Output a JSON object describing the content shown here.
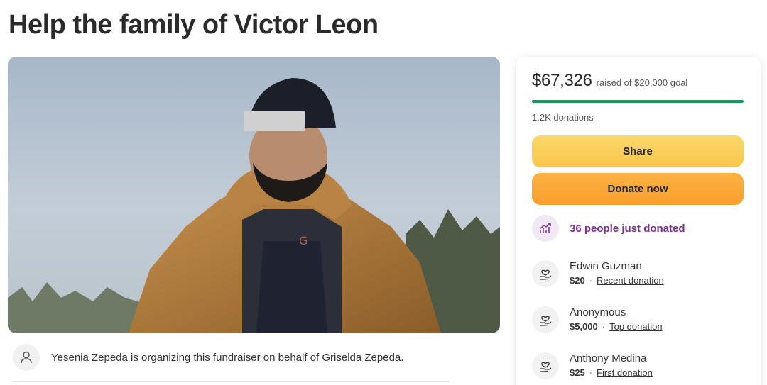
{
  "page": {
    "title": "Help the family of Victor Leon"
  },
  "organizer": {
    "text": "Yesenia Zepeda is organizing this fundraiser on behalf of Griselda Zepeda."
  },
  "card": {
    "raised": "$67,326",
    "goal_text": "raised of $20,000 goal",
    "progress_fraction": 1.0,
    "donations_count": "1.2K donations",
    "share_label": "Share",
    "donate_label": "Donate now",
    "trend_text": "36 people just donated",
    "donors": [
      {
        "name": "Edwin Guzman",
        "amount": "$20",
        "tag": "Recent donation"
      },
      {
        "name": "Anonymous",
        "amount": "$5,000",
        "tag": "Top donation"
      },
      {
        "name": "Anthony Medina",
        "amount": "$25",
        "tag": "First donation"
      }
    ]
  },
  "colors": {
    "progress": "#0e9d58",
    "share_button": "#f6c649",
    "donate_button": "#f79f2c",
    "trend_text": "#7b2f8e"
  },
  "icons": {
    "organizer": "person-icon",
    "trend": "trending-up-icon",
    "donor": "hand-heart-icon"
  }
}
